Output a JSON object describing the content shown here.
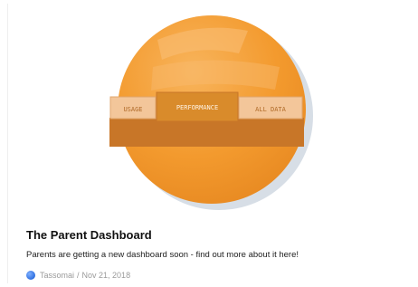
{
  "post": {
    "title": "The Parent Dashboard",
    "excerpt": "Parents are getting a new dashboard soon - find out more about it here!",
    "author": "Tassomai",
    "separator": "/",
    "date": "Nov 21, 2018"
  },
  "hero": {
    "tabs": [
      "USAGE",
      "PERFORMANCE",
      "ALL DATA"
    ],
    "active_tab": "PERFORMANCE",
    "colors": {
      "circle": "#f39a2e",
      "circle_light": "#f7b35a",
      "tab_inactive": "#f3c69a",
      "tab_active": "#d98b2b",
      "panel": "#c87628",
      "shadow": "#cfd8e0"
    }
  },
  "icons": {
    "author_avatar": "author-avatar-icon"
  }
}
